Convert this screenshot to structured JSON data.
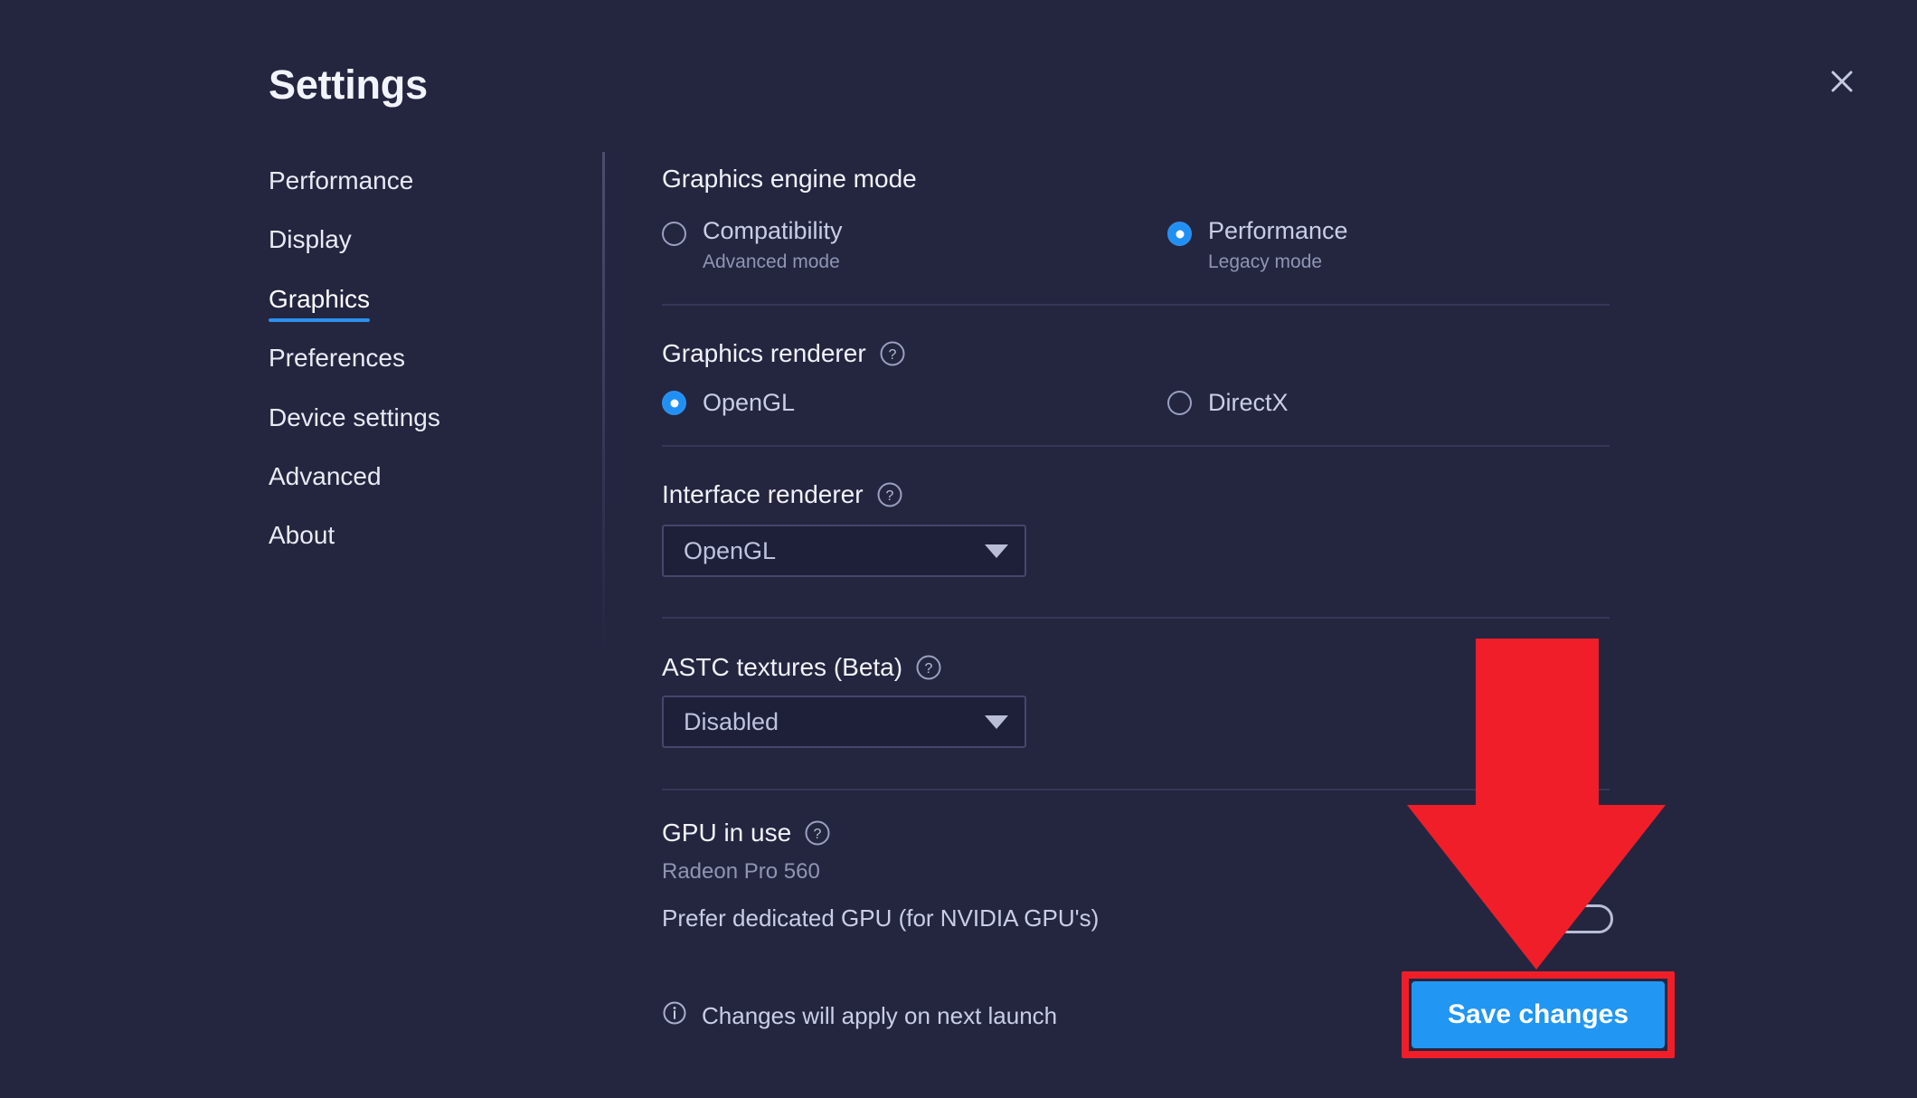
{
  "window": {
    "title": "Settings",
    "close_icon": "close-icon"
  },
  "sidebar": {
    "items": [
      {
        "label": "Performance",
        "active": false
      },
      {
        "label": "Display",
        "active": false
      },
      {
        "label": "Graphics",
        "active": true
      },
      {
        "label": "Preferences",
        "active": false
      },
      {
        "label": "Device settings",
        "active": false
      },
      {
        "label": "Advanced",
        "active": false
      },
      {
        "label": "About",
        "active": false
      }
    ],
    "active_underline_color": "#2e8fee"
  },
  "main": {
    "engine_mode": {
      "title": "Graphics engine mode",
      "options": [
        {
          "label": "Compatibility",
          "sublabel": "Advanced mode",
          "selected": false
        },
        {
          "label": "Performance",
          "sublabel": "Legacy mode",
          "selected": true
        }
      ]
    },
    "graphics_renderer": {
      "title": "Graphics renderer",
      "help_icon": "help-circle-icon",
      "options": [
        {
          "label": "OpenGL",
          "selected": true
        },
        {
          "label": "DirectX",
          "selected": false
        }
      ]
    },
    "interface_renderer": {
      "title": "Interface renderer",
      "help_icon": "help-circle-icon",
      "value": "OpenGL",
      "caret_icon": "chevron-down-icon"
    },
    "astc_textures": {
      "title": "ASTC textures (Beta)",
      "help_icon": "help-circle-icon",
      "value": "Disabled",
      "caret_icon": "chevron-down-icon"
    },
    "gpu": {
      "title": "GPU in use",
      "help_icon": "help-circle-icon",
      "device": "Radeon Pro 560",
      "prefer_dedicated_label": "Prefer dedicated GPU (for NVIDIA GPU's)",
      "prefer_dedicated_on": false
    }
  },
  "footer": {
    "info_icon": "info-circle-icon",
    "note": "Changes will apply on next launch",
    "save_label": "Save changes",
    "save_color": "#2196f3"
  },
  "annotation": {
    "arrow_color": "#f01e28",
    "highlight_color": "#f01e28"
  }
}
